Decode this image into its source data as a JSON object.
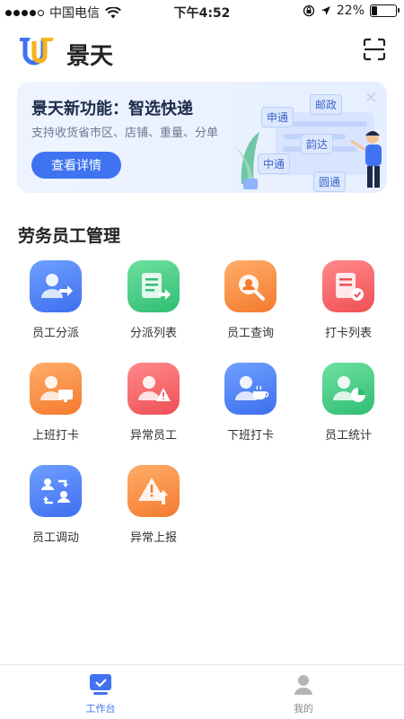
{
  "status_bar": {
    "carrier": "中国电信",
    "time": "下午4:52",
    "battery_text": "22%",
    "battery_level": 0.22
  },
  "header": {
    "title": "景天"
  },
  "banner": {
    "title": "景天新功能：智选快递",
    "subtitle": "支持收货省市区、店铺、重量、分单",
    "button_label": "查看详情",
    "tags": [
      "申通",
      "邮政",
      "韵达",
      "中通",
      "圆通"
    ]
  },
  "section": {
    "title": "劳务员工管理"
  },
  "grid": {
    "items": [
      {
        "label": "员工分派",
        "icon": "user-assign-icon",
        "color": "blue"
      },
      {
        "label": "分派列表",
        "icon": "assign-list-icon",
        "color": "green"
      },
      {
        "label": "员工查询",
        "icon": "user-search-icon",
        "color": "orange"
      },
      {
        "label": "打卡列表",
        "icon": "clock-list-icon",
        "color": "red"
      },
      {
        "label": "上班打卡",
        "icon": "clock-in-icon",
        "color": "orange"
      },
      {
        "label": "异常员工",
        "icon": "abnormal-user-icon",
        "color": "red"
      },
      {
        "label": "下班打卡",
        "icon": "clock-out-icon",
        "color": "blue"
      },
      {
        "label": "员工统计",
        "icon": "user-stats-icon",
        "color": "green"
      },
      {
        "label": "员工调动",
        "icon": "user-transfer-icon",
        "color": "blue"
      },
      {
        "label": "异常上报",
        "icon": "report-abnormal-icon",
        "color": "orange"
      }
    ]
  },
  "tabbar": {
    "tabs": [
      {
        "label": "工作台",
        "active": true
      },
      {
        "label": "我的",
        "active": false
      }
    ]
  },
  "colors": {
    "accent": "#3f73f1",
    "tab_active": "#3f73f1",
    "tab_inactive": "#8a8a8a"
  }
}
